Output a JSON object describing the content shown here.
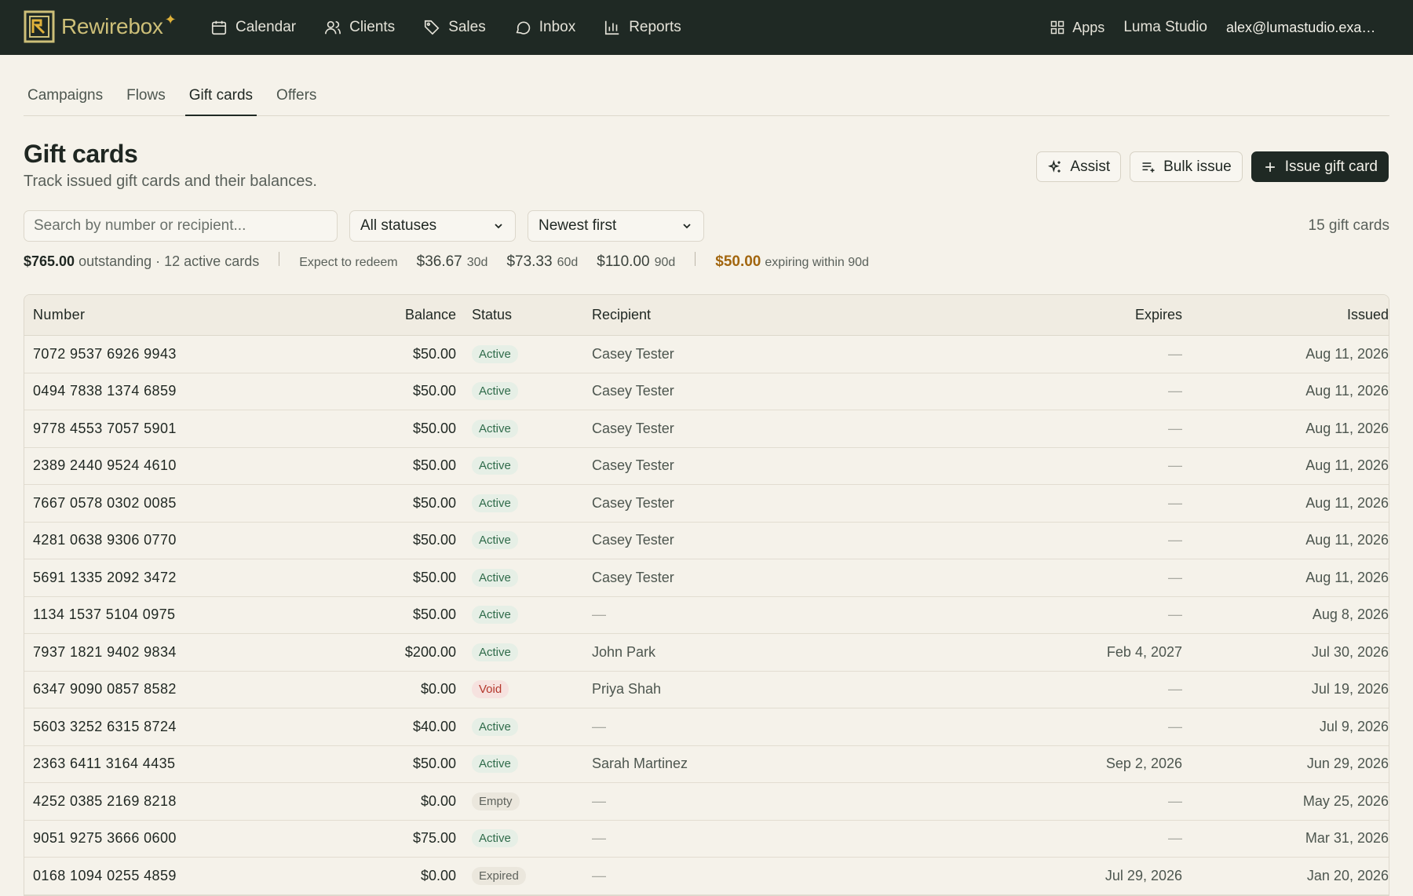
{
  "app": {
    "name": "Rewirebox",
    "nav": [
      "Calendar",
      "Clients",
      "Sales",
      "Inbox",
      "Reports"
    ],
    "apps_label": "Apps",
    "studio": "Luma Studio",
    "email": "alex@lumastudio.example.com"
  },
  "subtabs": [
    "Campaigns",
    "Flows",
    "Gift cards",
    "Offers"
  ],
  "active_subtab": "Gift cards",
  "header": {
    "title": "Gift cards",
    "subtitle": "Track issued gift cards and their balances.",
    "assist_label": "Assist",
    "bulk_label": "Bulk issue",
    "issue_label": "Issue gift card"
  },
  "filters": {
    "search_placeholder": "Search by number or recipient...",
    "status": "All statuses",
    "sort": "Newest first",
    "count": "15 gift cards"
  },
  "summary": {
    "outstanding": "$765.00",
    "outstanding_text": "outstanding · 12 active cards",
    "expect_label": "Expect to redeem",
    "amt30": "$36.67",
    "lbl30": "30d",
    "amt60": "$73.33",
    "lbl60": "60d",
    "amt90": "$110.00",
    "lbl90": "90d",
    "expiring": "$50.00",
    "expiring_text": "expiring within 90d"
  },
  "table": {
    "columns": [
      "Number",
      "Balance",
      "Status",
      "Recipient",
      "Expires",
      "Issued"
    ],
    "rows": [
      {
        "number": "7072 9537 6926 9943",
        "balance": "$50.00",
        "status": "Active",
        "recipient": "Casey Tester",
        "expires": "—",
        "issued": "Aug 11, 2026"
      },
      {
        "number": "0494 7838 1374 6859",
        "balance": "$50.00",
        "status": "Active",
        "recipient": "Casey Tester",
        "expires": "—",
        "issued": "Aug 11, 2026"
      },
      {
        "number": "9778 4553 7057 5901",
        "balance": "$50.00",
        "status": "Active",
        "recipient": "Casey Tester",
        "expires": "—",
        "issued": "Aug 11, 2026"
      },
      {
        "number": "2389 2440 9524 4610",
        "balance": "$50.00",
        "status": "Active",
        "recipient": "Casey Tester",
        "expires": "—",
        "issued": "Aug 11, 2026"
      },
      {
        "number": "7667 0578 0302 0085",
        "balance": "$50.00",
        "status": "Active",
        "recipient": "Casey Tester",
        "expires": "—",
        "issued": "Aug 11, 2026"
      },
      {
        "number": "4281 0638 9306 0770",
        "balance": "$50.00",
        "status": "Active",
        "recipient": "Casey Tester",
        "expires": "—",
        "issued": "Aug 11, 2026"
      },
      {
        "number": "5691 1335 2092 3472",
        "balance": "$50.00",
        "status": "Active",
        "recipient": "Casey Tester",
        "expires": "—",
        "issued": "Aug 11, 2026"
      },
      {
        "number": "1134 1537 5104 0975",
        "balance": "$50.00",
        "status": "Active",
        "recipient": "—",
        "expires": "—",
        "issued": "Aug 8, 2026"
      },
      {
        "number": "7937 1821 9402 9834",
        "balance": "$200.00",
        "status": "Active",
        "recipient": "John Park",
        "expires": "Feb 4, 2027",
        "issued": "Jul 30, 2026"
      },
      {
        "number": "6347 9090 0857 8582",
        "balance": "$0.00",
        "status": "Void",
        "recipient": "Priya Shah",
        "expires": "—",
        "issued": "Jul 19, 2026"
      },
      {
        "number": "5603 3252 6315 8724",
        "balance": "$40.00",
        "status": "Active",
        "recipient": "—",
        "expires": "—",
        "issued": "Jul 9, 2026"
      },
      {
        "number": "2363 6411 3164 4435",
        "balance": "$50.00",
        "status": "Active",
        "recipient": "Sarah Martinez",
        "expires": "Sep 2, 2026",
        "issued": "Jun 29, 2026"
      },
      {
        "number": "4252 0385 2169 8218",
        "balance": "$0.00",
        "status": "Empty",
        "recipient": "—",
        "expires": "—",
        "issued": "May 25, 2026"
      },
      {
        "number": "9051 9275 3666 0600",
        "balance": "$75.00",
        "status": "Active",
        "recipient": "—",
        "expires": "—",
        "issued": "Mar 31, 2026"
      },
      {
        "number": "0168 1094 0255 4859",
        "balance": "$0.00",
        "status": "Expired",
        "recipient": "—",
        "expires": "Jul 29, 2026",
        "issued": "Jan 20, 2026"
      }
    ]
  }
}
